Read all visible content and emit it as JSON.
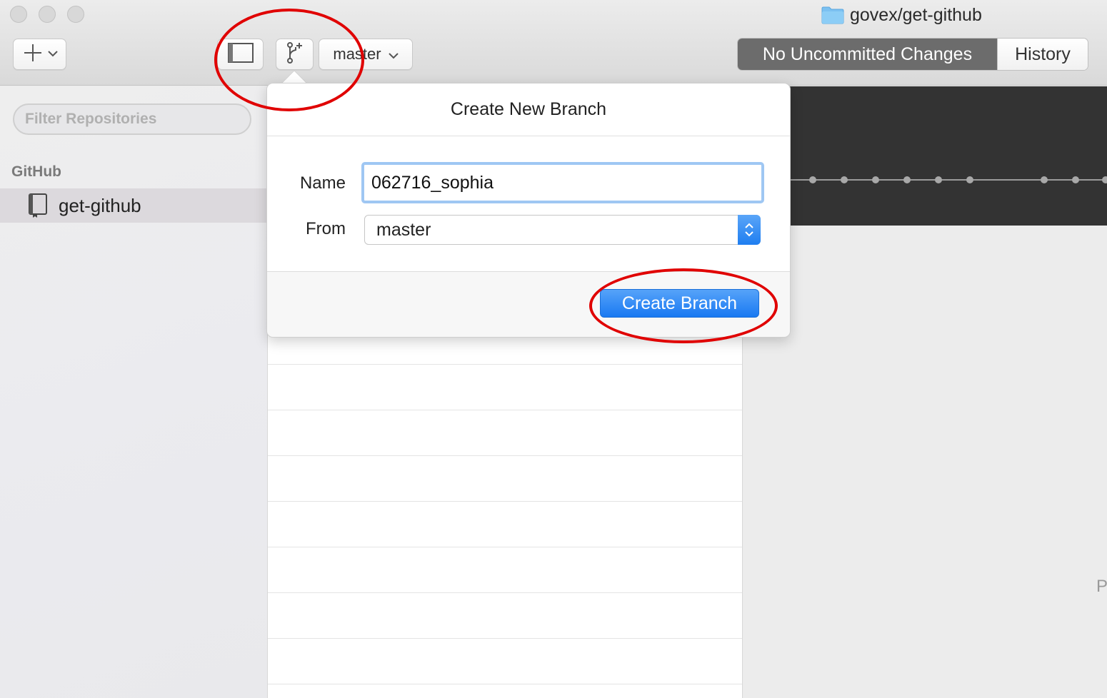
{
  "window": {
    "title": "govex/get-github"
  },
  "toolbar": {
    "add_button_icon": "plus-icon",
    "sidebar_toggle_icon": "sidebar-toggle-icon",
    "new_branch_icon": "branch-icon",
    "branch_selector_label": "master",
    "segments": {
      "changes_label": "No Uncommitted Changes",
      "history_label": "History"
    }
  },
  "sidebar": {
    "filter_placeholder": "Filter Repositories",
    "section_label": "GitHub",
    "repos": [
      {
        "name": "get-github",
        "icon": "repo-book-icon",
        "selected": true
      }
    ]
  },
  "popover": {
    "title": "Create New Branch",
    "name_label": "Name",
    "name_value": "062716_sophia",
    "from_label": "From",
    "from_value": "master",
    "create_label": "Create Branch"
  },
  "right_panel": {
    "edge_text": "P"
  },
  "colors": {
    "accent_blue": "#1f7ef0",
    "annotation_red": "#e00000",
    "segment_active": "#6c6c6c",
    "timeline_background": "#333333"
  }
}
